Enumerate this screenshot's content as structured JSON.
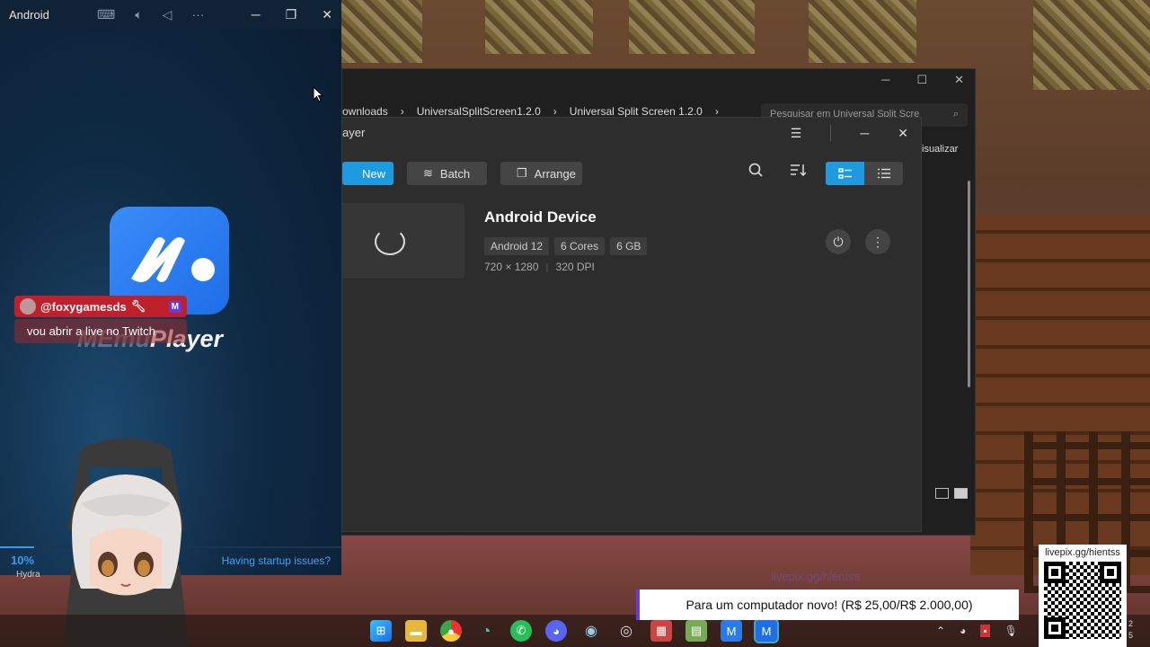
{
  "emulator": {
    "title": "Android",
    "progress_pct_value": 10,
    "progress_label": "10%",
    "startup_link": "Having startup issues?",
    "brand": "MEmu Player",
    "brand_faded": "MEmu",
    "brand_rest": "Player",
    "footer_text": "Hydra"
  },
  "chat": {
    "username": "@foxygamesds",
    "badge": "M",
    "message": "vou abrir a live no Twitch"
  },
  "explorer": {
    "breadcrumb": [
      "ownloads",
      "UniversalSplitScreen1.2.0",
      "Universal Split Screen 1.2.0"
    ],
    "search_placeholder": "Pesquisar em Universal Split Scre",
    "visualize_label": "isualizar"
  },
  "manager": {
    "title": "ayer",
    "toolbar": {
      "new_label": "New",
      "batch_label": "Batch",
      "arrange_label": "Arrange"
    },
    "device": {
      "name": "Android Device",
      "tags": [
        "Android 12",
        "6 Cores",
        "6 GB"
      ],
      "resolution": "720 × 1280",
      "dpi": "320 DPI"
    }
  },
  "overlay": {
    "donation": "Para um computador novo! (R$ 25,00/R$ 2.000,00)",
    "livepix_url": "livepix.gg/hientss",
    "ghost_text": "livepix.gg/hientss"
  },
  "taskbar": {
    "time_partial": "2",
    "date_partial": "5"
  },
  "colors": {
    "accent_blue": "#1e9ae0",
    "donation_purple": "#6a3ad8",
    "chat_red": "#c0202a"
  }
}
